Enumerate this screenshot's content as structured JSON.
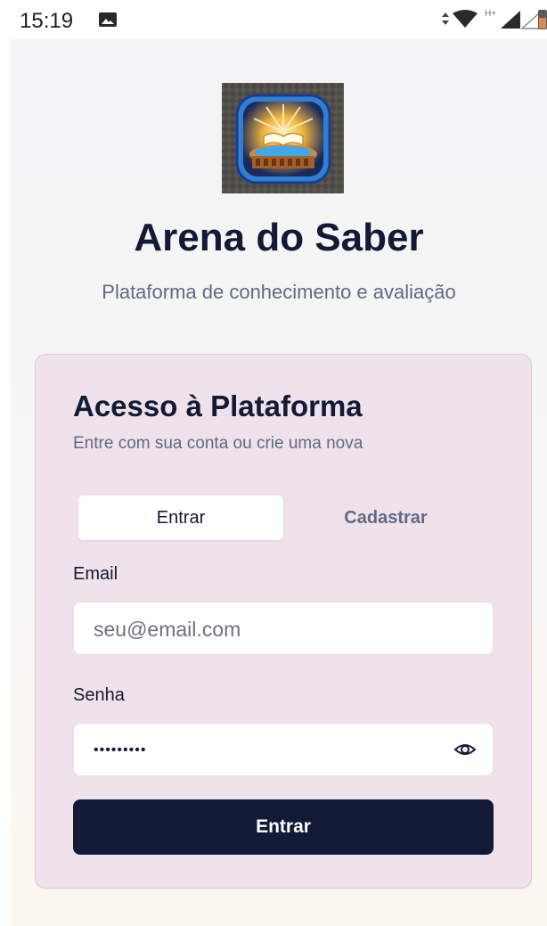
{
  "status_bar": {
    "time": "15:19",
    "network_label": "H+",
    "icons": [
      "image-icon",
      "data-arrows-icon",
      "wifi-icon",
      "signal-icon",
      "signal-empty-icon",
      "battery-icon"
    ]
  },
  "app": {
    "title": "Arena do Saber",
    "subtitle": "Plataforma de conhecimento e avaliação",
    "logo_icon": "arena-book-logo"
  },
  "card": {
    "title": "Acesso à Plataforma",
    "description": "Entre com sua conta ou crie uma nova",
    "tabs": [
      {
        "label": "Entrar",
        "active": true
      },
      {
        "label": "Cadastrar",
        "active": false
      }
    ],
    "email": {
      "label": "Email",
      "placeholder": "seu@email.com",
      "value": ""
    },
    "password": {
      "label": "Senha",
      "value": "•••••••••"
    },
    "submit_label": "Entrar"
  },
  "colors": {
    "primary": "#121a35",
    "muted_text": "#5d6b85",
    "card_bg": "#efe2ea"
  }
}
